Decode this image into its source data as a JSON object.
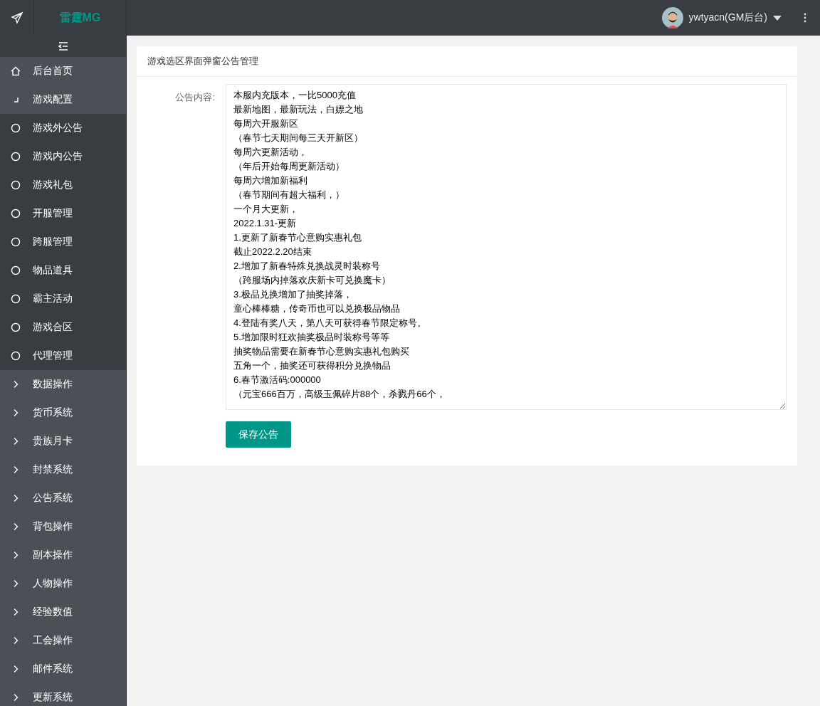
{
  "header": {
    "logo": "雷霆MG",
    "user": "ywtyacn(GM后台)"
  },
  "sidebar": {
    "items": [
      {
        "label": "后台首页",
        "kind": "link"
      },
      {
        "label": "游戏配置",
        "kind": "group",
        "expanded": true,
        "children": [
          {
            "label": "游戏外公告"
          },
          {
            "label": "游戏内公告"
          },
          {
            "label": "游戏礼包"
          },
          {
            "label": "开服管理"
          },
          {
            "label": "跨服管理"
          },
          {
            "label": "物品道具"
          },
          {
            "label": "霸主活动"
          },
          {
            "label": "游戏合区"
          },
          {
            "label": "代理管理"
          }
        ]
      },
      {
        "label": "数据操作",
        "kind": "group",
        "expanded": false
      },
      {
        "label": "货币系统",
        "kind": "group",
        "expanded": false
      },
      {
        "label": "贵族月卡",
        "kind": "group",
        "expanded": false
      },
      {
        "label": "封禁系统",
        "kind": "group",
        "expanded": false
      },
      {
        "label": "公告系统",
        "kind": "group",
        "expanded": false
      },
      {
        "label": "背包操作",
        "kind": "group",
        "expanded": false
      },
      {
        "label": "副本操作",
        "kind": "group",
        "expanded": false
      },
      {
        "label": "人物操作",
        "kind": "group",
        "expanded": false
      },
      {
        "label": "经验数值",
        "kind": "group",
        "expanded": false
      },
      {
        "label": "工会操作",
        "kind": "group",
        "expanded": false
      },
      {
        "label": "邮件系统",
        "kind": "group",
        "expanded": false
      },
      {
        "label": "更新系统",
        "kind": "group",
        "expanded": false
      }
    ]
  },
  "card": {
    "title": "游戏选区界面弹窗公告管理",
    "field_label": "公告内容:",
    "content_lines": [
      "本服内充版本，一比5000充值",
      "最新地图，最新玩法，白嫖之地",
      "每周六开服新区",
      "（春节七天期间每三天开新区）",
      "每周六更新活动，",
      "（年后开始每周更新活动）",
      "每周六增加新福利",
      "（春节期间有超大福利，）",
      "一个月大更新，",
      "2022.1.31-更新",
      "1.更新了新春节心意购实惠礼包",
      "截止2022.2.20结束",
      "2.增加了新春特殊兑换战灵时装称号",
      "（跨服场内掉落欢庆新卡可兑换魔卡）",
      "3.极品兑换增加了抽奖掉落，",
      "童心棒棒糖，传奇币也可以兑换极品物品",
      "4.登陆有奖八天，第八天可获得春节限定称号。",
      "5.增加限时狂欢抽奖极品时装称号等等",
      "抽奖物品需要在新春节心意购实惠礼包购买",
      "五角一个，抽奖还可获得积分兑换物品",
      "6.春节激活码:000000",
      "（元宝666百万，高级玉佩碎片88个，杀戮丹66个，"
    ],
    "save_button": "保存公告"
  }
}
